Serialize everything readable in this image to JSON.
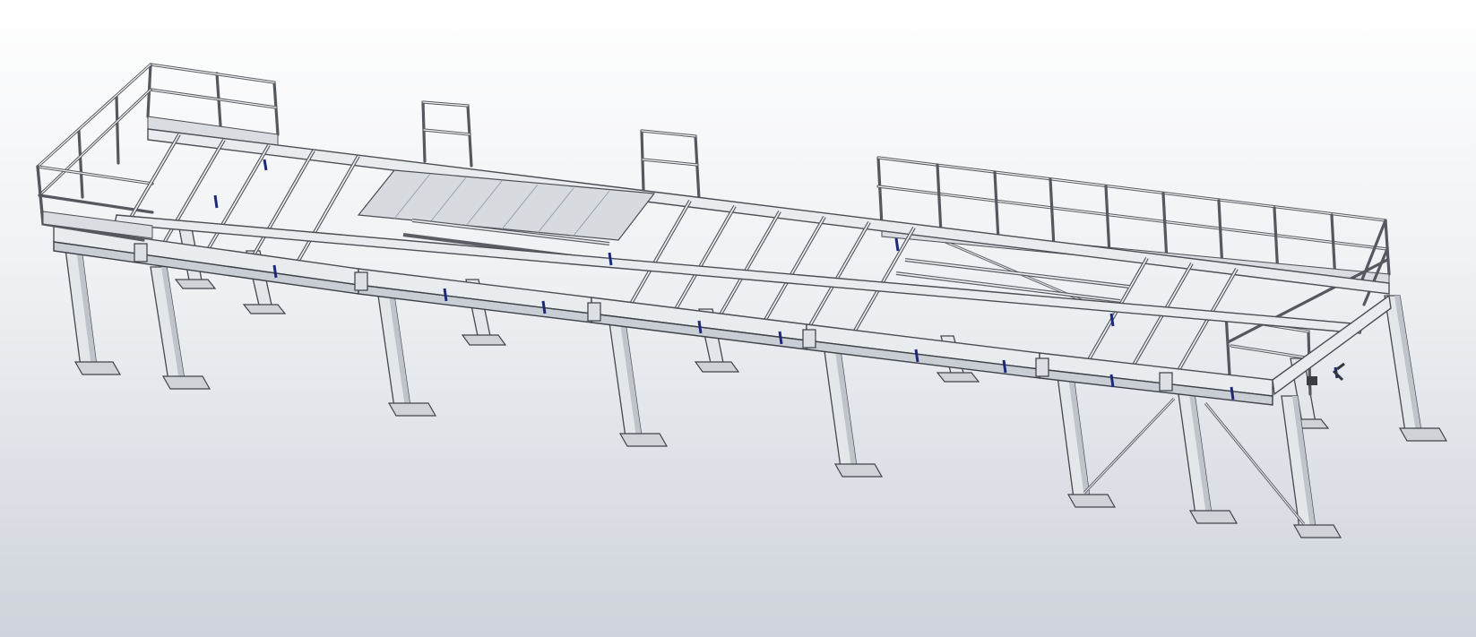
{
  "scene": {
    "subject": "",
    "colors": {
      "background_top": "#ffffff",
      "background_bottom": "#cfd3db",
      "steel": "#e9ecef",
      "edge": "#4a4d52",
      "clip": "#1d2a7a"
    }
  }
}
